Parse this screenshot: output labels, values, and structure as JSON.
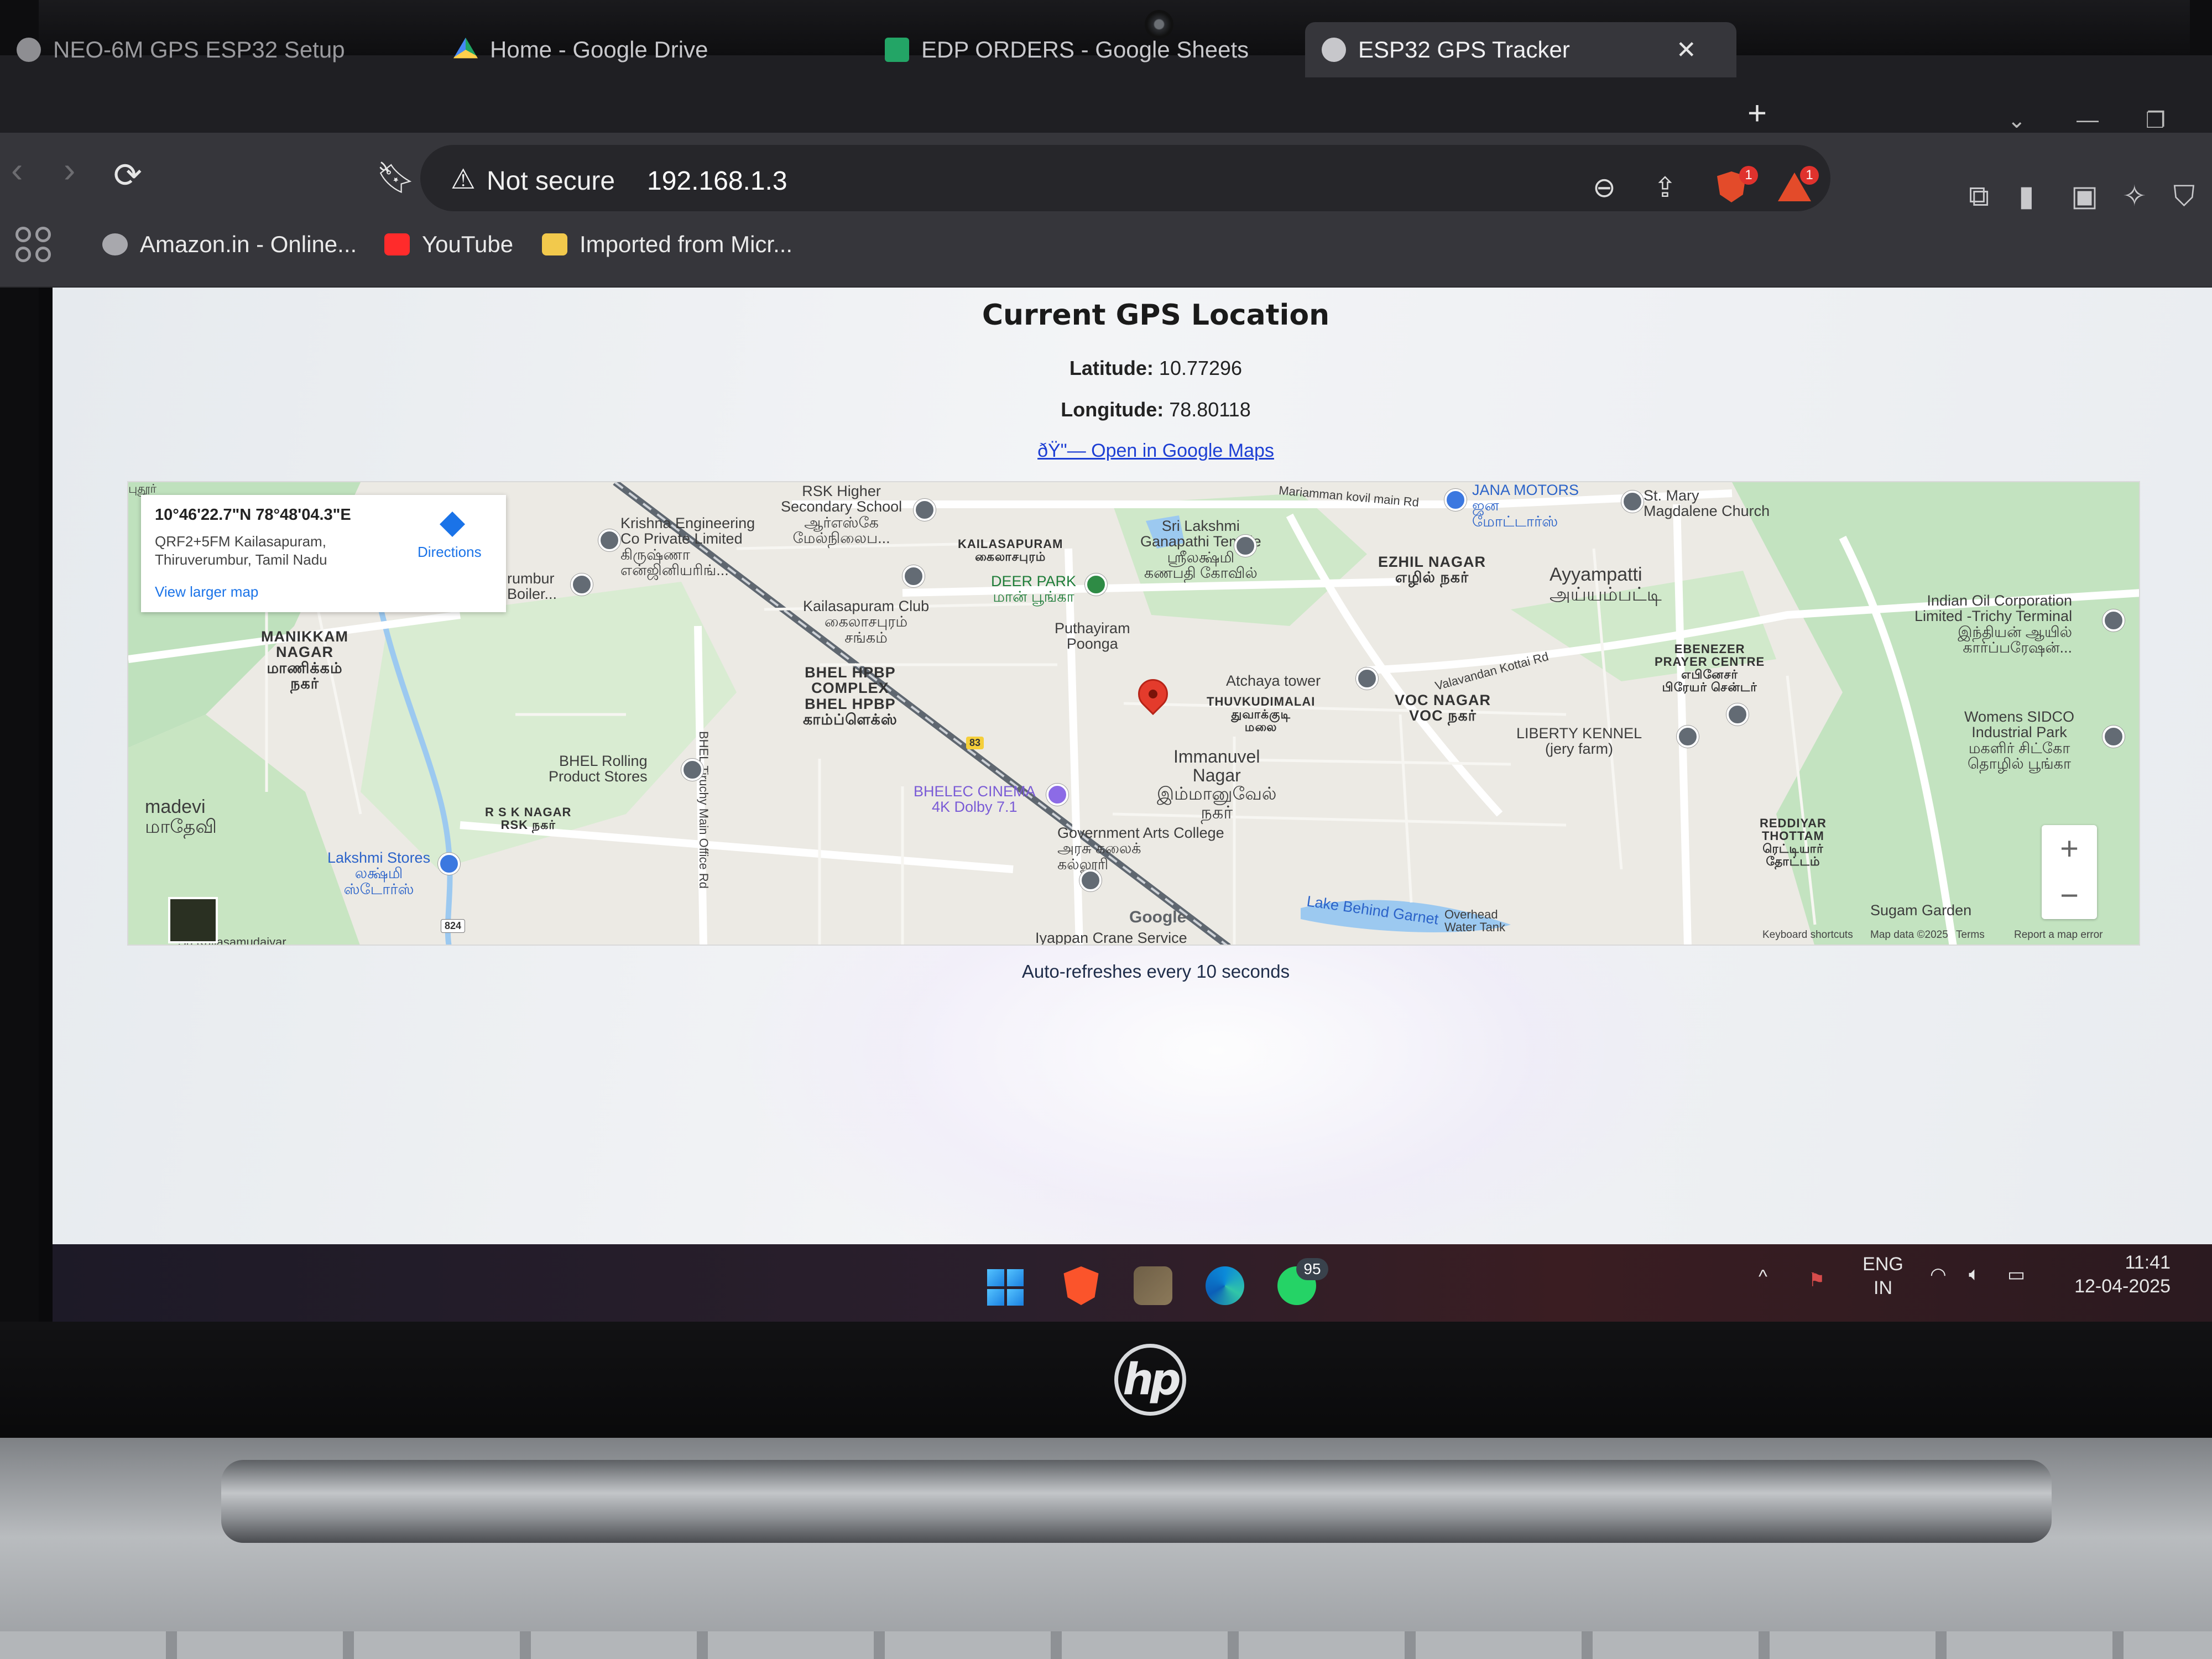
{
  "tabs": [
    {
      "label": "NEO-6M GPS ESP32 Setup",
      "icon": "chatgpt-icon"
    },
    {
      "label": "Home - Google Drive",
      "icon": "google-drive-icon"
    },
    {
      "label": "EDP ORDERS - Google Sheets",
      "icon": "google-sheets-icon"
    },
    {
      "label": "ESP32 GPS Tracker",
      "icon": "globe-icon",
      "active": true
    }
  ],
  "address_bar": {
    "security_label": "Not secure",
    "url": "192.168.1.3"
  },
  "bookmarks": [
    {
      "label": "Amazon.in - Online...",
      "icon": "globe-icon"
    },
    {
      "label": "YouTube",
      "icon": "youtube-icon"
    },
    {
      "label": "Imported from Micr...",
      "icon": "folder-icon"
    }
  ],
  "extension_badges": {
    "brave_shield": "1",
    "brave_rewards": "1"
  },
  "page": {
    "title": "Current GPS Location",
    "latitude_label": "Latitude:",
    "latitude_value": "10.77296",
    "longitude_label": "Longitude:",
    "longitude_value": "78.80118",
    "maps_link": "ðŸ\"— Open in Google Maps",
    "refresh_note": "Auto-refreshes every 10 seconds"
  },
  "map": {
    "info_card": {
      "coords": "10°46'22.7\"N 78°48'04.3\"E",
      "address_line1": "QRF2+5FM Kailasapuram,",
      "address_line2": "Thiruverumbur, Tamil Nadu",
      "view_larger": "View larger map",
      "directions": "Directions"
    },
    "labels": {
      "rsk_school": "RSK Higher\nSecondary School\nஆர்எஸ்கே\nமேல்நிலைப...",
      "krishna": "Krishna Engineering\nCo Private Limited\nகிருஷ்ணா\nஎன்ஜினியரிங்...",
      "kailasapuram": "KAILASAPURAM\nகைலாசபுரம்",
      "sri_lakshmi": "Sri Lakshmi\nGanapathi Temple\nஸ்ரீலக்ஷ்மி\nகணபதி கோவில்",
      "mariamman": "Mariamman kovil main Rd",
      "jana_motors": "JANA MOTORS\nஜன\nமோட்டார்ஸ்",
      "st_mary": "St. Mary\nMagdalene Church",
      "ezhil_nagar": "EZHIL NAGAR\nஎழில் நகர்",
      "ayyampatti": "Ayyampatti\nஅய்யம்பட்டி",
      "indian_oil": "Indian Oil Corporation\nLimited -Trichy Terminal\nஇந்தியன் ஆயில்\nகார்ப்பரேஷன்...",
      "deer_park": "DEER PARK\nமான் பூங்கா",
      "kailasapuram_club": "Kailasapuram Club\nகைலாசபுரம்\nசங்கம்",
      "puthayiram": "Puthayiram\nPoonga",
      "thiruverumbur_boiler": "rumbur\nBoiler...",
      "manikkam": "MANIKKAM\nNAGAR\nமாணிக்கம்\nநகர்",
      "bhel_hpbp": "BHEL HPBP\nCOMPLEX\nBHEL HPBP\nகாம்ப்ளெக்ஸ்",
      "atchaya": "Atchaya tower",
      "thuvkudimalai": "THUVKUDIMALAI\nதுவாக்குடி\nமலை",
      "valavandan": "Valavandan Kottai Rd",
      "voc_nagar": "VOC NAGAR\nVOC நகர்",
      "ebenezer": "EBENEZER\nPRAYER CENTRE\nஎபினேசர்\nபிரேயர் சென்டர்",
      "liberty": "LIBERTY KENNEL\n(jery farm)",
      "womens_sidco": "Womens SIDCO\nIndustrial Park\nமகளிர் சிட்கோ\nதொழில் பூங்கா",
      "bhel_rolling": "BHEL Rolling\nProduct Stores",
      "bhel_road": "BHEL Tiruchy Main Office Rd",
      "bhelec": "BHELEC CINEMA\n4K Dolby 7.1",
      "immanuvel": "Immanuvel\nNagar\nஇம்மானுவேல்\nநகர்",
      "govt_arts": "Government Arts College\nஅரசு கலைக்\nகல்லூரி",
      "rsk_nagar": "R S K NAGAR\nRSK நகர்",
      "madevi": "madevi\nமாதேவி",
      "lakshmi_stores": "Lakshmi Stores\nலக்ஷ்மி\nஸ்டோர்ஸ்",
      "reddiyar": "REDDIYAR\nTHOTTAM\nரெட்டியார்\nதோட்டம்",
      "lake": "Lake Behind Garnet",
      "overhead": "Overhead\nWater Tank",
      "ayyappan": "Iyappan Crane Service",
      "sugam": "Sugam Garden",
      "edge_top": "புதூர்",
      "edge_bottom": "Sri Kailasamudaiyar"
    },
    "route_badges": {
      "r83": "83",
      "r824": "824"
    },
    "google_word": "Google",
    "footer": {
      "shortcuts": "Keyboard shortcuts",
      "map_data": "Map data ©2025",
      "terms": "Terms",
      "report": "Report a map error"
    },
    "zoom_in": "+",
    "zoom_out": "−"
  },
  "taskbar": {
    "whatsapp_badge": "95",
    "language_line1": "ENG",
    "language_line2": "IN",
    "time": "11:41",
    "date": "12-04-2025"
  },
  "device": {
    "logo": "hp"
  },
  "colors": {
    "page_bg": "#eef0f3",
    "link": "#1d3fd4",
    "pin": "#e43b2c",
    "browser_dark": "#36363b"
  }
}
